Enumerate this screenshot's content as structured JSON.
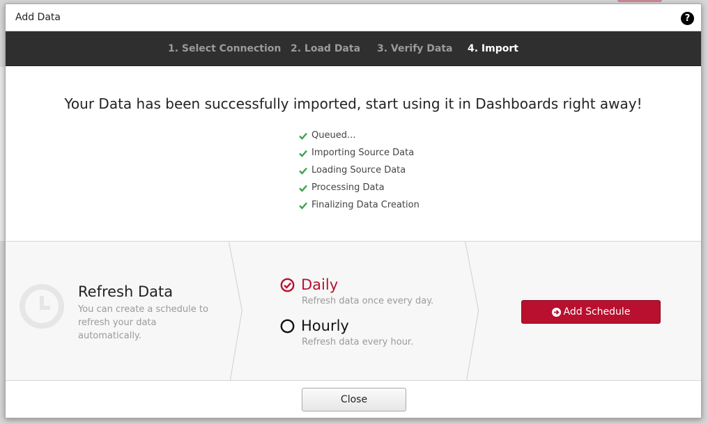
{
  "modal": {
    "title": "Add Data",
    "help_icon": "question-circle-icon"
  },
  "steps": [
    {
      "label": "1. Select Connection",
      "active": false
    },
    {
      "label": "2. Load Data",
      "active": false
    },
    {
      "label": "3. Verify Data",
      "active": false
    },
    {
      "label": "4. Import",
      "active": true
    }
  ],
  "headline": "Your Data has been successfully imported, start using it in Dashboards right away!",
  "progress_items": [
    {
      "label": "Queued...",
      "icon": "check-icon",
      "done": true
    },
    {
      "label": "Importing Source Data",
      "icon": "check-icon",
      "done": true
    },
    {
      "label": "Loading Source Data",
      "icon": "check-icon",
      "done": true
    },
    {
      "label": "Processing Data",
      "icon": "check-icon",
      "done": true
    },
    {
      "label": "Finalizing Data Creation",
      "icon": "check-icon",
      "done": true
    }
  ],
  "refresh": {
    "title": "Refresh Data",
    "description": "You can create a schedule to refresh your data automatically.",
    "icon": "clock-icon",
    "options": [
      {
        "label": "Daily",
        "description": "Refresh data once every day.",
        "selected": true
      },
      {
        "label": "Hourly",
        "description": "Refresh data every hour.",
        "selected": false
      }
    ],
    "add_schedule_label": "Add Schedule",
    "add_schedule_icon": "arrow-circle-right-icon"
  },
  "close_label": "Close",
  "colors": {
    "accent": "#b8102e",
    "check": "#3aa346",
    "stepbar": "#2f2f2f"
  }
}
